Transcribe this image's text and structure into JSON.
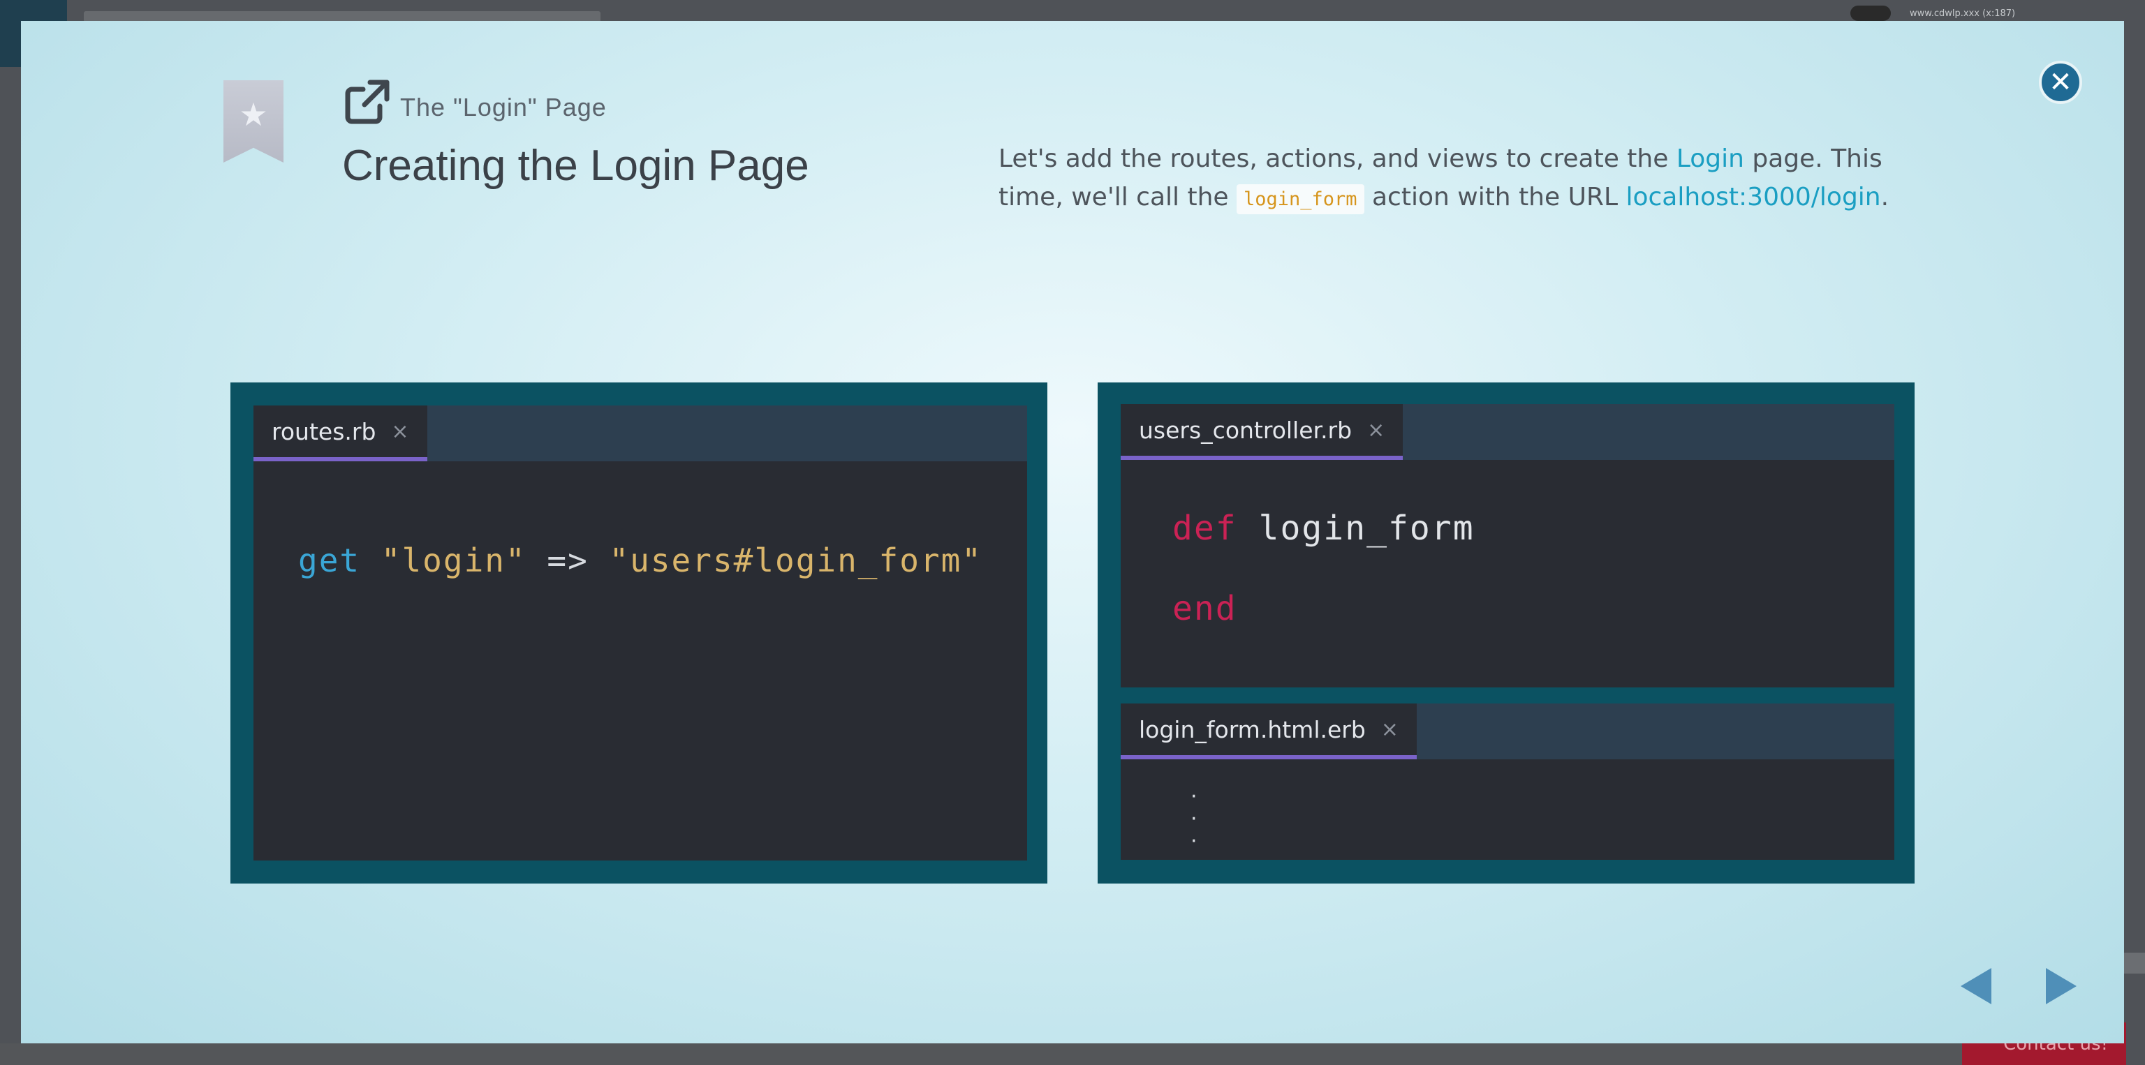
{
  "background": {
    "url_text": "www.cdwlp.xxx (x:187)",
    "contact_label": "Contact us!"
  },
  "header": {
    "subtitle": "The \"Login\" Page",
    "title": "Creating the Login Page"
  },
  "description": {
    "part1": "Let's add the routes, actions, and views to create the ",
    "link_login": "Login",
    "part2": " page. This time, we'll call the ",
    "code": "login_form",
    "part3": " action with the URL ",
    "link_url": "localhost:3000/login",
    "part4": "."
  },
  "panels": {
    "routes": {
      "tab_label": "routes.rb",
      "close_glyph": "×",
      "code": {
        "keyword": "get",
        "arg1": "\"login\"",
        "operator": "=>",
        "arg2": "\"users#login_form\""
      }
    },
    "controller": {
      "tab_label": "users_controller.rb",
      "close_glyph": "×",
      "code": {
        "def_keyword": "def",
        "method_name": "login_form",
        "end_keyword": "end"
      }
    },
    "view": {
      "tab_label": "login_form.html.erb",
      "close_glyph": "×",
      "dots": "·\n·\n·"
    }
  },
  "icons": {
    "bookmark": "bookmark-star-icon",
    "external": "external-link-icon",
    "close": "close-circle-icon",
    "prev": "triangle-left-icon",
    "next": "triangle-right-icon"
  },
  "colors": {
    "accent_link": "#1a9ec2",
    "panel_frame": "#0b5262",
    "editor_bg": "#292c33",
    "tab_underline": "#7a63c9",
    "keyword_red": "#cb2255",
    "keyword_blue": "#3aa6d6",
    "string_gold": "#d9b56b"
  }
}
